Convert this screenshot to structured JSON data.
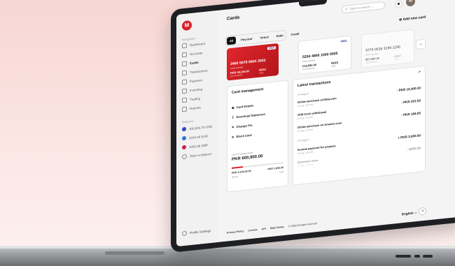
{
  "sidebar": {
    "logo": "M",
    "nav_heading": "Navigation",
    "items": [
      {
        "label": "Dashboard"
      },
      {
        "label": "Accounts"
      },
      {
        "label": "Cards"
      },
      {
        "label": "Transactions"
      },
      {
        "label": "Payment"
      },
      {
        "label": "Investing"
      },
      {
        "label": "Trading"
      },
      {
        "label": "Reports"
      }
    ],
    "balances_heading": "Balances",
    "balances": [
      {
        "label": "100,000.75 USD",
        "color": "#2b4db4"
      },
      {
        "label": "2245.46 EUR",
        "color": "#2a7bd1"
      },
      {
        "label": "3453.36 GBP",
        "color": "#d0214a"
      }
    ],
    "open_balance": "Open a balance",
    "profile_settings": "Profile Settings"
  },
  "header": {
    "title": "Cards",
    "search_placeholder": "Type to search ...",
    "add_card": "Add new card"
  },
  "tabs": [
    "All",
    "Physical",
    "Virtual",
    "Debit",
    "Credit"
  ],
  "cards": [
    {
      "number": "3400 5678 9804 3002",
      "number_label": "Card number",
      "balance": "PKR 48,280.00",
      "balance_label": "Card balance",
      "valid": "06/23",
      "valid_label": "Valid",
      "brand": "VISA"
    },
    {
      "number": "5204 4800 1000 0005",
      "number_label": "Card number",
      "balance": "€16,500.00",
      "balance_label": "Card balance",
      "valid": "09/24",
      "valid_label": "Valid",
      "brand": "VISA"
    },
    {
      "number": "3774 0016 1190 1150",
      "number_label": "Card number",
      "balance": "$57,900.00",
      "balance_label": "Card balance",
      "valid": "03/27",
      "valid_label": "Valid"
    }
  ],
  "management": {
    "title": "Card management",
    "items": [
      "Card Details",
      "Download Statement",
      "Change Pin",
      "Block Card"
    ],
    "limit_label": "Limit of transactions",
    "limit_value": "PKR 600,900.00",
    "spent": "PKR 3,100,20.00",
    "spent_label": "Spent",
    "left": "PKR 1,650.00",
    "left_label": "Left",
    "progress": 0.22
  },
  "transactions": {
    "title": "Latest transactions",
    "groups": [
      {
        "date": "24 August",
        "items": [
          {
            "title": "Online purchase at Ebay.com",
            "sub": "24 Aug, 3:40 PM",
            "amount": "- PKR 10,400.00"
          },
          {
            "title": "ATM Cash withdrawal",
            "sub": "24 Aug, 2:15 AM",
            "amount": "- PKR 201.50"
          },
          {
            "title": "Online purchase on Amazon.com",
            "sub": "24 Aug, 1:40 PM",
            "amount": "- PKR 184.00"
          }
        ]
      },
      {
        "date": "24 August",
        "items": [
          {
            "title": "Income payment for projects",
            "sub": "24 Aug, 3:40 PM",
            "amount": "+ PKR 3,000.00"
          },
          {
            "title": "Groceries store",
            "sub": "24 Aug, 2:40 PM",
            "amount": "- $400.00"
          }
        ]
      }
    ]
  },
  "footer": {
    "links": [
      "Privacy Policy",
      "License",
      "API",
      "Help Center"
    ],
    "copyright": "© 2022 All rights reserved",
    "language": "English"
  }
}
